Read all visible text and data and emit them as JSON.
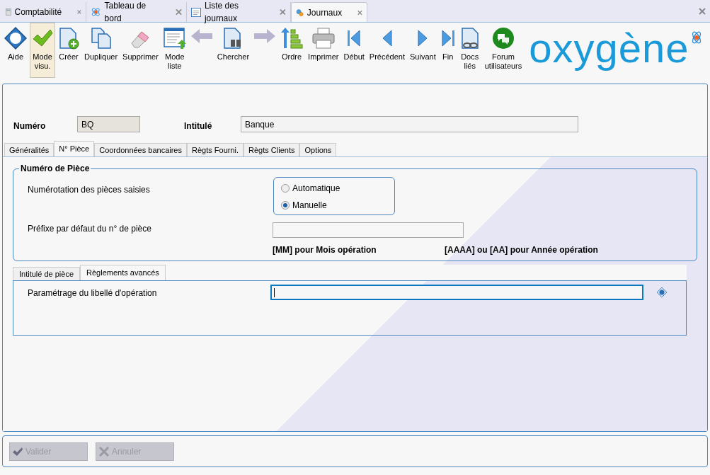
{
  "tabs": [
    {
      "label": "Comptabilité",
      "selected": false
    },
    {
      "label": "Tableau de bord",
      "selected": false
    },
    {
      "label": "Liste des journaux",
      "selected": false
    },
    {
      "label": "Journaux",
      "selected": true
    }
  ],
  "toolbar": [
    {
      "label": "Aide",
      "selected": false
    },
    {
      "label": "Mode visu.",
      "selected": true
    },
    {
      "label": "Créer",
      "selected": false
    },
    {
      "label": "Dupliquer",
      "selected": false
    },
    {
      "label": "Supprimer",
      "selected": false
    },
    {
      "label": "Mode liste",
      "selected": false
    },
    {
      "label": "Chercher",
      "selected": false
    },
    {
      "label": "Ordre",
      "selected": false
    },
    {
      "label": "Imprimer",
      "selected": false
    },
    {
      "label": "Début",
      "selected": false
    },
    {
      "label": "Précédent",
      "selected": false
    },
    {
      "label": "Suivant",
      "selected": false
    },
    {
      "label": "Fin",
      "selected": false
    },
    {
      "label": "Docs liés",
      "selected": false
    },
    {
      "label": "Forum utilisateurs",
      "selected": false
    }
  ],
  "logo": "oxygène",
  "header": {
    "numero_label": "Numéro",
    "numero_value": "BQ",
    "intitule_label": "Intitulé",
    "intitule_value": "Banque"
  },
  "form_tabs": [
    {
      "label": "Généralités",
      "selected": false
    },
    {
      "label": "N° Pièce",
      "selected": true
    },
    {
      "label": "Coordonnées bancaires",
      "selected": false
    },
    {
      "label": "Règts Fourni.",
      "selected": false
    },
    {
      "label": "Règts Clients",
      "selected": false
    },
    {
      "label": "Options",
      "selected": false
    }
  ],
  "group": {
    "title": "Numéro de Pièce",
    "numbering_label": "Numérotation des pièces saisies",
    "options": [
      {
        "label": "Automatique",
        "selected": false
      },
      {
        "label": "Manuelle",
        "selected": true
      }
    ],
    "prefix_label": "Préfixe par défaut du n° de pièce",
    "hint_month": "[MM] pour Mois opération",
    "hint_year": "[AAAA] ou [AA] pour Année opération"
  },
  "sub_tabs": [
    {
      "label": "Intitulé de pièce",
      "selected": false
    },
    {
      "label": "Règlements avancés",
      "selected": true
    }
  ],
  "libelle_label": "Paramétrage du libellé d'opération",
  "buttons": [
    {
      "label": "Valider",
      "disabled": true
    },
    {
      "label": "Annuler",
      "disabled": true
    }
  ]
}
